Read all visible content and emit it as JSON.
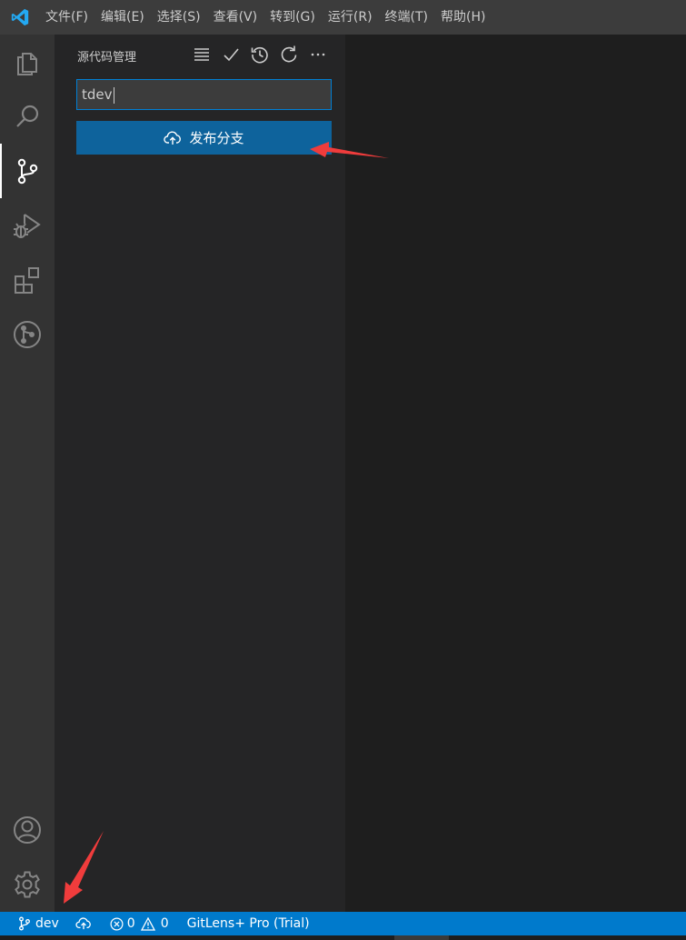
{
  "menu": {
    "items": [
      "文件(F)",
      "编辑(E)",
      "选择(S)",
      "查看(V)",
      "转到(G)",
      "运行(R)",
      "终端(T)",
      "帮助(H)"
    ]
  },
  "activitybar": {
    "items": [
      "explorer-icon",
      "search-icon",
      "source-control-icon",
      "run-debug-icon",
      "extensions-icon",
      "gitlens-icon"
    ],
    "bottom": [
      "accounts-icon",
      "manage-gear-icon"
    ]
  },
  "sidebar": {
    "title": "源代码管理",
    "actions": [
      "view-as-list-icon",
      "commit-check-icon",
      "history-icon",
      "refresh-icon",
      "more-actions-icon"
    ],
    "commit_input_value": "tdev",
    "publish_button_label": "发布分支"
  },
  "statusbar": {
    "branch": "dev",
    "errors": "0",
    "warnings": "0",
    "gitlens": "GitLens+ Pro (Trial)"
  },
  "colors": {
    "accent": "#007acc",
    "button": "#0e639c",
    "annotation": "#f03c3c"
  }
}
